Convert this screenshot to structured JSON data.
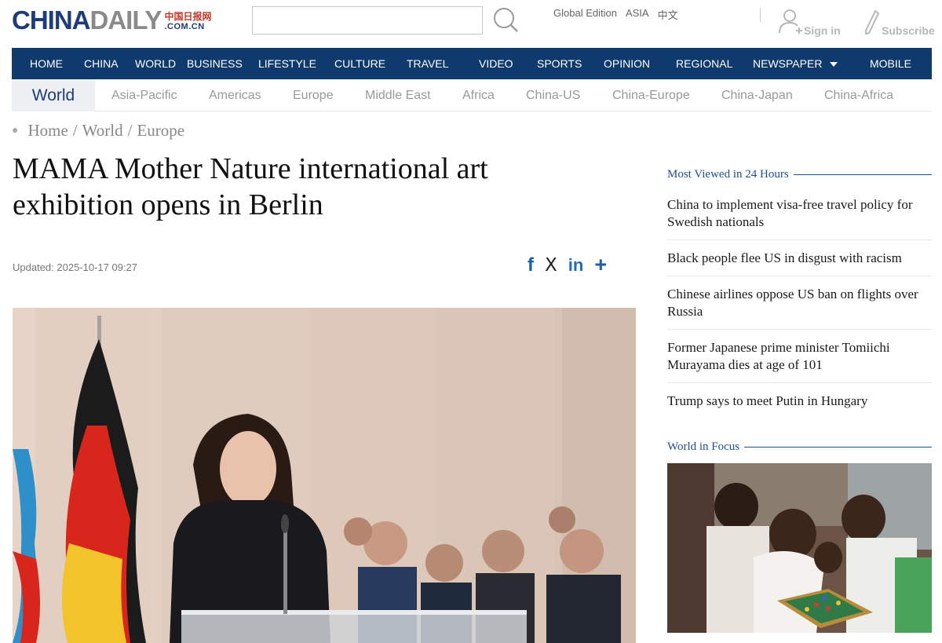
{
  "header": {
    "logo_main": "CHINA",
    "logo_second": "DAILY",
    "logo_cn": "中国日报网",
    "logo_domain": ".COM.CN",
    "search_placeholder": "",
    "editions": [
      "Global Edition",
      "ASIA",
      "中文"
    ],
    "sign_in": "Sign in",
    "subscribe": "Subscribe"
  },
  "mainnav": {
    "items": [
      "HOME",
      "CHINA",
      "WORLD",
      "BUSINESS",
      "LIFESTYLE",
      "CULTURE",
      "TRAVEL",
      "VIDEO",
      "SPORTS",
      "OPINION",
      "REGIONAL",
      "NEWSPAPER",
      "MOBILE"
    ]
  },
  "subnav": {
    "current": "World",
    "items": [
      "Asia-Pacific",
      "Americas",
      "Europe",
      "Middle East",
      "Africa",
      "China-US",
      "China-Europe",
      "China-Japan",
      "China-Africa"
    ]
  },
  "breadcrumb": {
    "items": [
      "Home",
      "World",
      "Europe"
    ],
    "separator": "/"
  },
  "article": {
    "headline": "MAMA Mother Nature international art exhibition opens in Berlin",
    "updated": "Updated: 2025-10-17 09:27",
    "share_icons": [
      "facebook-icon",
      "x-icon",
      "linkedin-icon",
      "plus-icon"
    ],
    "share_glyphs": [
      "f",
      "X",
      "in",
      "+"
    ]
  },
  "sidebar": {
    "most_viewed_title": "Most Viewed in 24 Hours",
    "most_viewed": [
      "China to implement visa-free travel policy for Swedish nationals",
      "Black people flee US in disgust with racism",
      "Chinese airlines oppose US ban on flights over Russia",
      "Former Japanese prime minister Tomiichi Murayama dies at age of 101",
      "Trump says to meet Putin in Hungary"
    ],
    "focus_title": "World in Focus"
  },
  "colors": {
    "nav_bg": "#0f3a6e",
    "brand_blue": "#1d3d7a",
    "accent_blue": "#1d4f91",
    "subnav_active_bg": "#eef0f3"
  }
}
